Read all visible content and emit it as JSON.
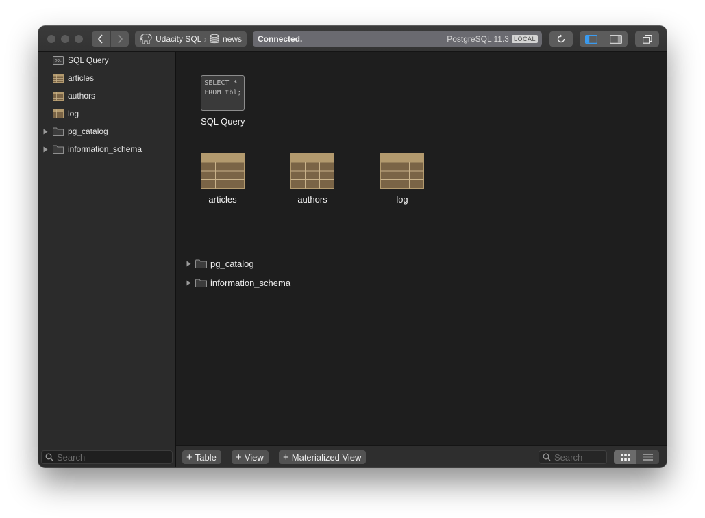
{
  "titlebar": {
    "connection_name": "Udacity SQL",
    "database_name": "news",
    "status": "Connected.",
    "server_version": "PostgreSQL 11.3",
    "env_badge": "LOCAL"
  },
  "sidebar": {
    "items": [
      {
        "label": "SQL Query",
        "icon": "sql-query-icon"
      },
      {
        "label": "articles",
        "icon": "table-icon"
      },
      {
        "label": "authors",
        "icon": "table-icon"
      },
      {
        "label": "log",
        "icon": "table-icon"
      },
      {
        "label": "pg_catalog",
        "icon": "folder-icon",
        "expandable": true
      },
      {
        "label": "information_schema",
        "icon": "folder-icon",
        "expandable": true
      }
    ],
    "search_placeholder": "Search"
  },
  "main": {
    "sql_query": {
      "label": "SQL Query",
      "preview_line1": "SELECT *",
      "preview_line2": "FROM tbl;"
    },
    "tables": [
      {
        "label": "articles"
      },
      {
        "label": "authors"
      },
      {
        "label": "log"
      }
    ],
    "schemas": [
      {
        "label": "pg_catalog"
      },
      {
        "label": "information_schema"
      }
    ]
  },
  "bottombar": {
    "add_table": "Table",
    "add_view": "View",
    "add_materialized_view": "Materialized View",
    "search_placeholder": "Search",
    "view_mode": "grid"
  },
  "colors": {
    "table_icon": "#7a6446",
    "table_icon_header": "#b39a6e",
    "sidebar_bg": "#2b2b2b",
    "main_bg": "#1e1e1e",
    "accent_blue": "#2f8de4"
  }
}
